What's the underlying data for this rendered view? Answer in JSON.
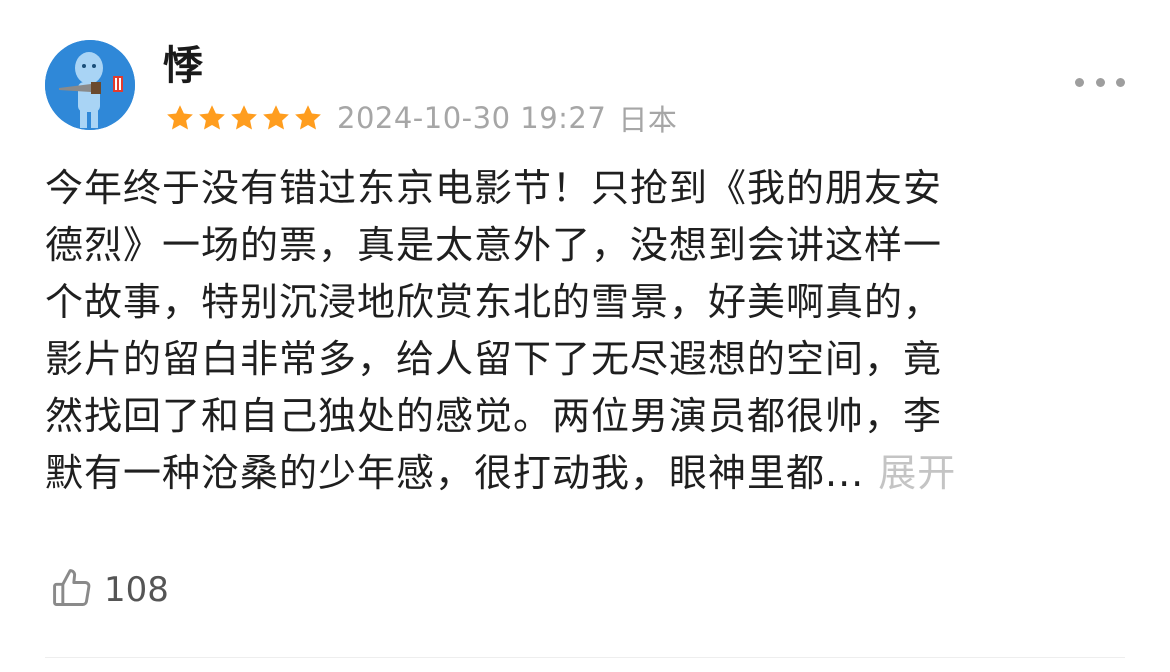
{
  "review": {
    "username": "悸",
    "rating": 5,
    "timestamp": "2024-10-30 19:27",
    "location": "日本",
    "text_lines": [
      "今年终于没有错过东京电影节！只抢到《我的朋友安",
      "德烈》一场的票，真是太意外了，没想到会讲这样一",
      "个故事，特别沉浸地欣赏东北的雪景，好美啊真的，",
      "影片的留白非常多，给人留下了无尽遐想的空间，竟",
      "然找回了和自己独处的感觉。两位男演员都很帅，李",
      "默有一种沧桑的少年感，很打动我，眼神里都..."
    ],
    "expand_label": "展开",
    "like_count": "108"
  },
  "colors": {
    "star": "#ff9d1e",
    "avatar_bg": "#2f88d8",
    "meta_text": "#a6a6a6",
    "expand": "#c4c4c4"
  },
  "icons": {
    "more": "more-icon",
    "like": "thumbs-up-icon",
    "star": "star-icon"
  }
}
